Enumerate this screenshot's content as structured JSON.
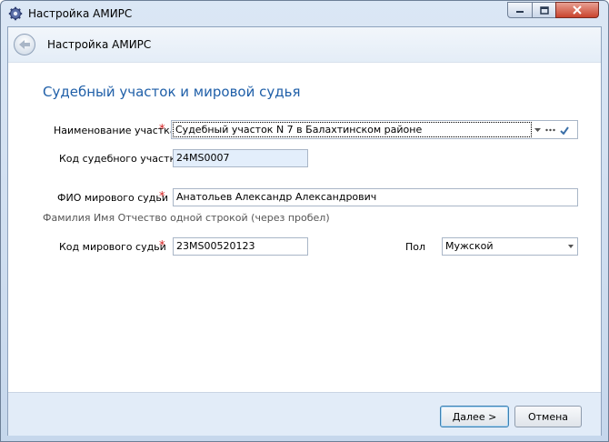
{
  "window": {
    "title": "Настройка АМИРС"
  },
  "header": {
    "title": "Настройка АМИРС"
  },
  "section": {
    "title": "Судебный участок и мировой судья"
  },
  "form": {
    "court_name": {
      "label": "Наименование участка",
      "value": "Судебный участок N 7 в Балахтинском районе"
    },
    "court_code": {
      "label": "Код судебного участка",
      "value": "24MS0007"
    },
    "judge_name": {
      "label": "ФИО мирового судьи",
      "value": "Анатольев Александр Александрович",
      "hint": "Фамилия Имя Отчество одной строкой (через пробел)"
    },
    "judge_code": {
      "label": "Код мирового судьи",
      "value": "23MS00520123"
    },
    "gender": {
      "label": "Пол",
      "value": "Мужской"
    }
  },
  "buttons": {
    "next": "Далее >",
    "cancel": "Отмена"
  },
  "colors": {
    "accent": "#1f5fa8",
    "required": "#d42020",
    "readonly_field": "#e3eefb",
    "footer": "#e2ecf8"
  }
}
